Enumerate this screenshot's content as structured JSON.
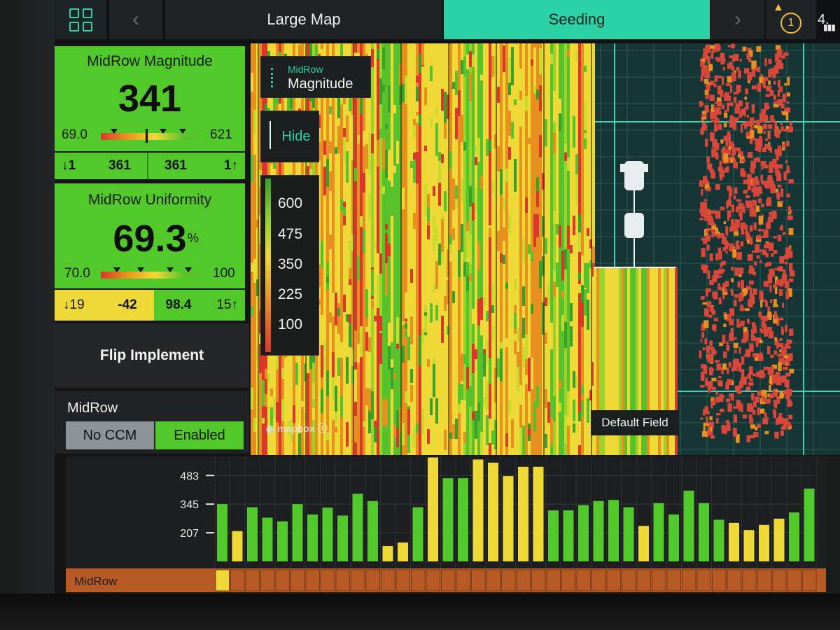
{
  "topbar": {
    "prev_icon": "‹",
    "next_icon": "›",
    "tabs": [
      {
        "label": "Large Map",
        "active": false
      },
      {
        "label": "Seeding",
        "active": true
      }
    ],
    "alert_count": "1",
    "status_partial": "4."
  },
  "magnitude": {
    "title": "MidRow Magnitude",
    "value": "341",
    "min": "69.0",
    "max": "621",
    "left_count": "1",
    "left_value": "361",
    "right_value": "361",
    "right_count": "1"
  },
  "uniformity": {
    "title": "MidRow Uniformity",
    "value": "69.3",
    "unit": "%",
    "min": "70.0",
    "max": "100",
    "left_count": "19",
    "left_value": "-42",
    "right_value": "98.4",
    "right_count": "15"
  },
  "flip_label": "Flip Implement",
  "midrow": {
    "label": "MidRow",
    "options": [
      "No CCM",
      "Enabled"
    ],
    "selected": "Enabled"
  },
  "map": {
    "layer_category": "MidRow",
    "layer_name": "Magnitude",
    "hide_label": "Hide",
    "legend": [
      "600",
      "475",
      "350",
      "225",
      "100"
    ],
    "attribution": "mapbox",
    "field_name": "Default Field"
  },
  "chart_data": {
    "type": "bar",
    "row_label": "MidRow",
    "y_ticks": [
      483,
      345,
      207
    ],
    "values": [
      345,
      215,
      330,
      280,
      262,
      345,
      295,
      328,
      290,
      395,
      360,
      143,
      160,
      330,
      570,
      470,
      470,
      560,
      545,
      480,
      525,
      525,
      315,
      315,
      340,
      360,
      365,
      330,
      240,
      350,
      295,
      410,
      350,
      270,
      255,
      220,
      245,
      275,
      305,
      420
    ],
    "colors": [
      "green",
      "yellow",
      "green",
      "green",
      "green",
      "green",
      "green",
      "green",
      "green",
      "green",
      "green",
      "yellow",
      "yellow",
      "green",
      "yellow",
      "green",
      "green",
      "yellow",
      "yellow",
      "yellow",
      "yellow",
      "yellow",
      "green",
      "green",
      "green",
      "green",
      "green",
      "green",
      "yellow",
      "green",
      "green",
      "green",
      "green",
      "green",
      "yellow",
      "yellow",
      "yellow",
      "yellow",
      "green",
      "green"
    ],
    "palette": {
      "green": "#52c92a",
      "yellow": "#efd936",
      "row": "#b85a25",
      "row_highlight": "#efd936"
    }
  }
}
